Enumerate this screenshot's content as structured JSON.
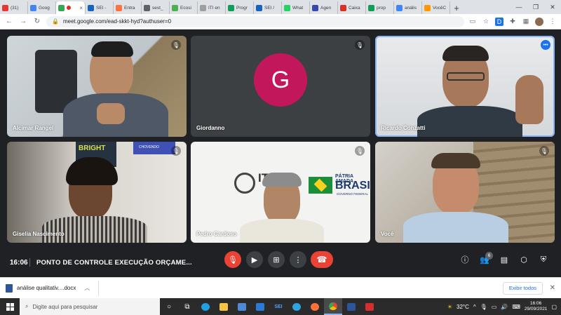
{
  "browser": {
    "tabs": [
      {
        "label": "(31)",
        "color": "#e53935"
      },
      {
        "label": "Goog",
        "color": "#4285f4"
      },
      {
        "label": "",
        "color": "#34a853",
        "active": true
      },
      {
        "label": "SEI -",
        "color": "#1565c0"
      },
      {
        "label": "Entra",
        "color": "#ff7043"
      },
      {
        "label": "sest_",
        "color": "#5f6368"
      },
      {
        "label": "Ecosi",
        "color": "#4caf50"
      },
      {
        "label": "ITI en",
        "color": "#9e9e9e"
      },
      {
        "label": "Progr",
        "color": "#0f9d58"
      },
      {
        "label": "SEI /",
        "color": "#1565c0"
      },
      {
        "label": "What",
        "color": "#25d366"
      },
      {
        "label": "Agen",
        "color": "#3949ab"
      },
      {
        "label": "Caixa",
        "color": "#d93025"
      },
      {
        "label": "prop",
        "color": "#0f9d58"
      },
      {
        "label": "anális",
        "color": "#4285f4"
      },
      {
        "label": "VocêC",
        "color": "#ff9800"
      }
    ],
    "url": "meet.google.com/ead-skkt-hyd?authuser=0"
  },
  "meet": {
    "participants": [
      {
        "name": "Alcimar Rangel",
        "muted": true
      },
      {
        "name": "Giordanno",
        "muted": true,
        "initial": "G"
      },
      {
        "name": "Ricardo Conzatti",
        "speaking": true
      },
      {
        "name": "Giselia Nascimento",
        "muted": true
      },
      {
        "name": "Pedro Cardoso",
        "muted": true
      },
      {
        "name": "Você",
        "muted": true
      }
    ],
    "time": "16:06",
    "meeting_title": "PONTO DE CONTROLE EXECUÇÃO ORÇAME...",
    "participant_count": "6",
    "scene_text": {
      "bright": "BRIGHT",
      "chovendo": "CHOVENDO",
      "iti": "ITI",
      "patria": "PÁTRIA AMADA",
      "brasil": "BRASIL",
      "gov": "GOVERNO FEDERAL"
    }
  },
  "downloads": {
    "file": "análise qualitativ....docx",
    "show_all": "Exibir todos"
  },
  "taskbar": {
    "search_placeholder": "Digite aqui para pesquisar",
    "weather": "32°C",
    "time": "16:06",
    "date": "29/09/2021",
    "sei_label": "SEI"
  }
}
